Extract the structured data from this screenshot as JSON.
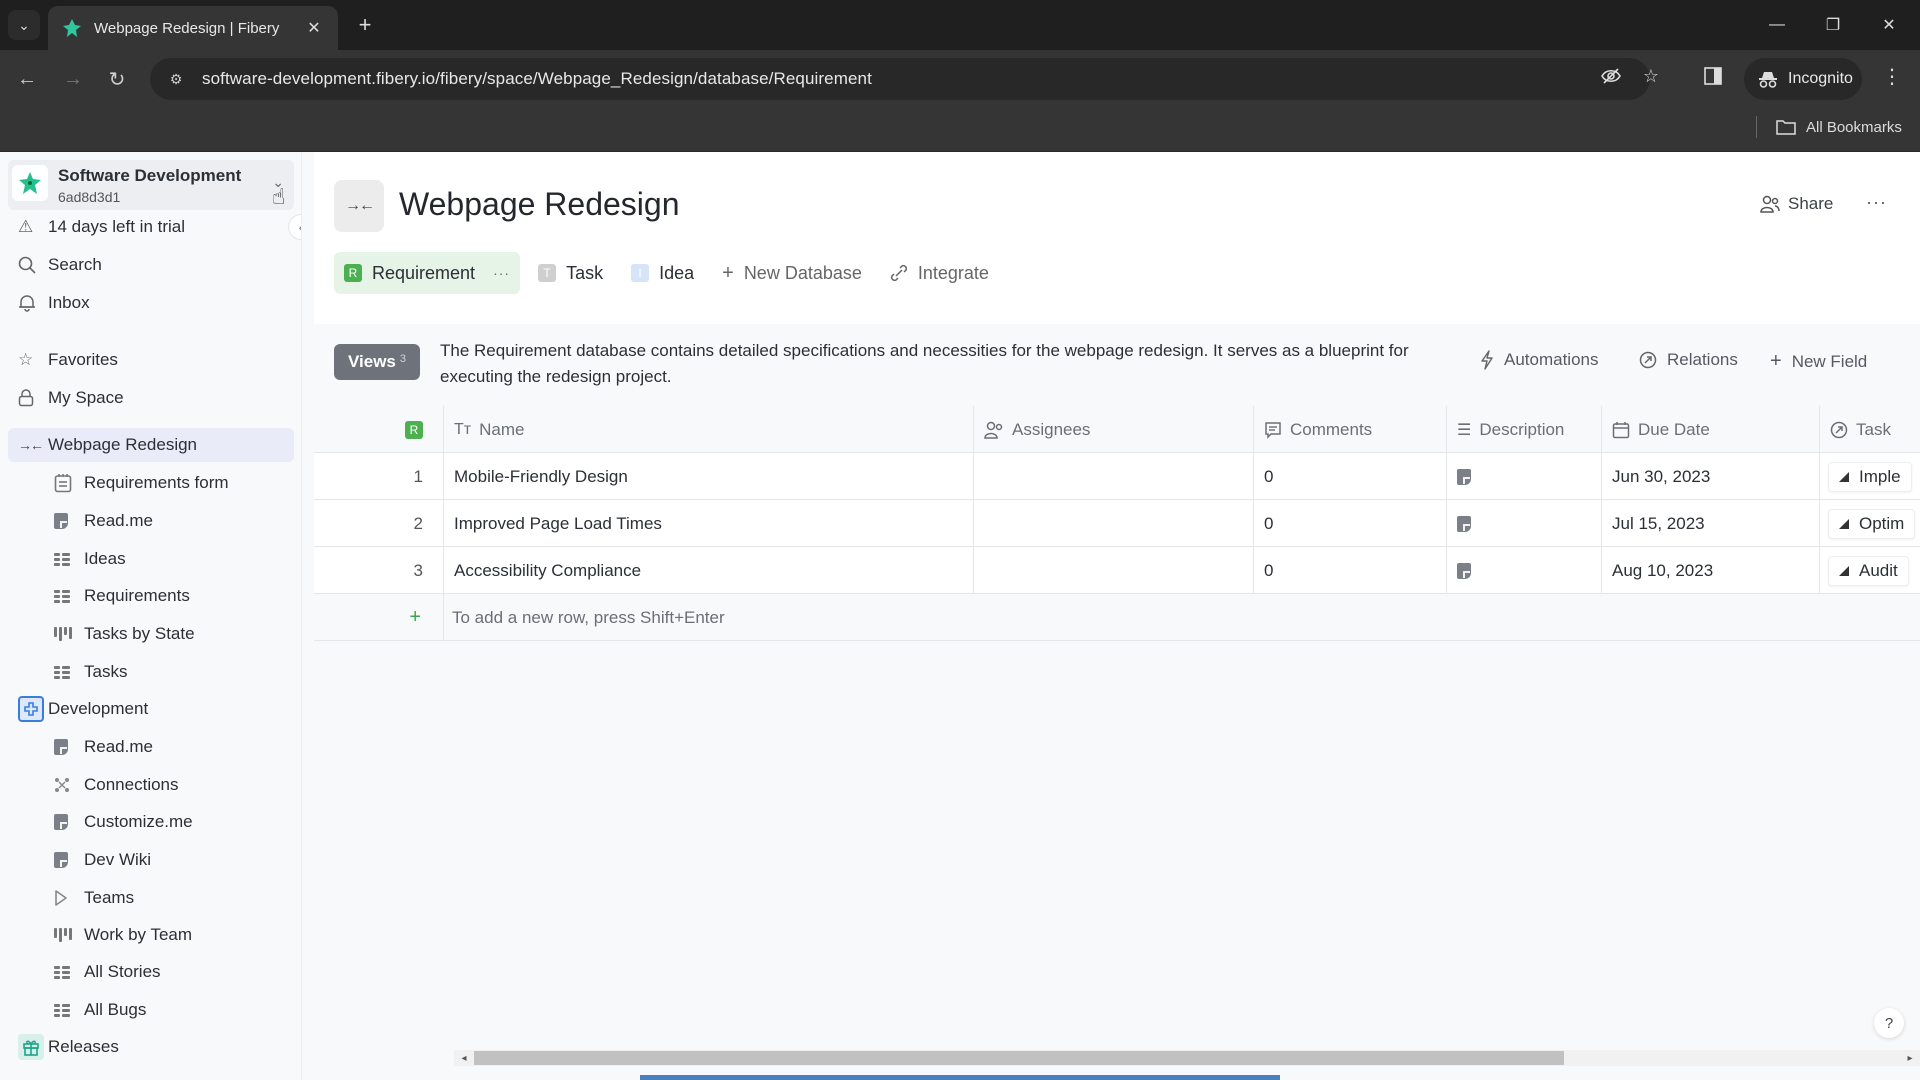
{
  "browser": {
    "tab_title": "Webpage Redesign | Fibery",
    "url": "software-development.fibery.io/fibery/space/Webpage_Redesign/database/Requirement",
    "incognito_label": "Incognito",
    "bookmarks_label": "All Bookmarks",
    "icons": {
      "tab_list": "chevron-down-icon",
      "close_tab": "close-icon",
      "new_tab": "plus-icon",
      "back": "arrow-left-icon",
      "forward": "arrow-right-icon",
      "reload": "reload-icon",
      "site_settings": "tune-icon",
      "eye_off": "eye-off-icon",
      "bookmark_star": "star-icon",
      "side_panel": "side-panel-icon",
      "menu": "kebab-icon"
    }
  },
  "sidebar": {
    "workspace_name": "Software Development",
    "workspace_id": "6ad8d3d1",
    "items": [
      {
        "label": "14 days left in trial",
        "icon": "warning-icon"
      },
      {
        "label": "Search",
        "icon": "search-icon"
      },
      {
        "label": "Inbox",
        "icon": "bell-icon"
      },
      {
        "label": "Favorites",
        "icon": "star-icon"
      },
      {
        "label": "My Space",
        "icon": "lock-icon"
      }
    ],
    "spaces": [
      {
        "label": "Webpage Redesign",
        "icon": "arrows-inward-icon",
        "active": true,
        "children": [
          {
            "label": "Requirements form",
            "icon": "form-icon"
          },
          {
            "label": "Read.me",
            "icon": "document-icon"
          },
          {
            "label": "Ideas",
            "icon": "table-view-icon"
          },
          {
            "label": "Requirements",
            "icon": "table-view-icon"
          },
          {
            "label": "Tasks by State",
            "icon": "board-view-icon"
          },
          {
            "label": "Tasks",
            "icon": "table-view-icon"
          }
        ]
      },
      {
        "label": "Development",
        "icon": "development-space-icon",
        "color": "#3b7ddd",
        "children": [
          {
            "label": "Read.me",
            "icon": "document-icon"
          },
          {
            "label": "Connections",
            "icon": "connections-icon"
          },
          {
            "label": "Customize.me",
            "icon": "document-icon"
          },
          {
            "label": "Dev Wiki",
            "icon": "document-icon"
          },
          {
            "label": "Teams",
            "icon": "triangle-right-icon"
          },
          {
            "label": "Work by Team",
            "icon": "board-view-icon"
          },
          {
            "label": "All Stories",
            "icon": "table-view-icon"
          },
          {
            "label": "All Bugs",
            "icon": "table-view-icon"
          }
        ]
      },
      {
        "label": "Releases",
        "icon": "gift-icon",
        "color": "#20a38a",
        "children": []
      }
    ]
  },
  "page": {
    "title": "Webpage Redesign",
    "share_label": "Share",
    "more_label": "···",
    "db_tabs": [
      {
        "label": "Requirement",
        "badge": "R",
        "color": "#4caf50",
        "active": true
      },
      {
        "label": "Task",
        "badge": "T",
        "color": "#cfcfcf"
      },
      {
        "label": "Idea",
        "badge": "I",
        "color": "#d6e4f7"
      },
      {
        "label": "New Database",
        "icon": "plus-icon"
      },
      {
        "label": "Integrate",
        "icon": "integrate-icon"
      }
    ],
    "views_label": "Views",
    "views_count": "3",
    "description": "The Requirement database contains detailed specifications and necessities for the webpage redesign. It serves as a blueprint for executing the redesign project.",
    "actions": {
      "automations": "Automations",
      "relations": "Relations",
      "new_field": "New Field"
    }
  },
  "table": {
    "type_badge": "R",
    "columns": [
      {
        "label": "Name",
        "icon": "text-type-icon"
      },
      {
        "label": "Assignees",
        "icon": "users-icon"
      },
      {
        "label": "Comments",
        "icon": "comment-icon"
      },
      {
        "label": "Description",
        "icon": "rich-text-icon"
      },
      {
        "label": "Due Date",
        "icon": "calendar-icon"
      },
      {
        "label": "Task",
        "icon": "relation-icon"
      }
    ],
    "rows": [
      {
        "num": "1",
        "name": "Mobile-Friendly Design",
        "assignees": "",
        "comments": "0",
        "due_date": "Jun 30, 2023",
        "task": "Imple"
      },
      {
        "num": "2",
        "name": "Improved Page Load Times",
        "assignees": "",
        "comments": "0",
        "due_date": "Jul 15, 2023",
        "task": "Optim"
      },
      {
        "num": "3",
        "name": "Accessibility Compliance",
        "assignees": "",
        "comments": "0",
        "due_date": "Aug 10, 2023",
        "task": "Audit"
      }
    ],
    "new_row_hint": "To add a new row, press Shift+Enter"
  },
  "help_label": "?"
}
